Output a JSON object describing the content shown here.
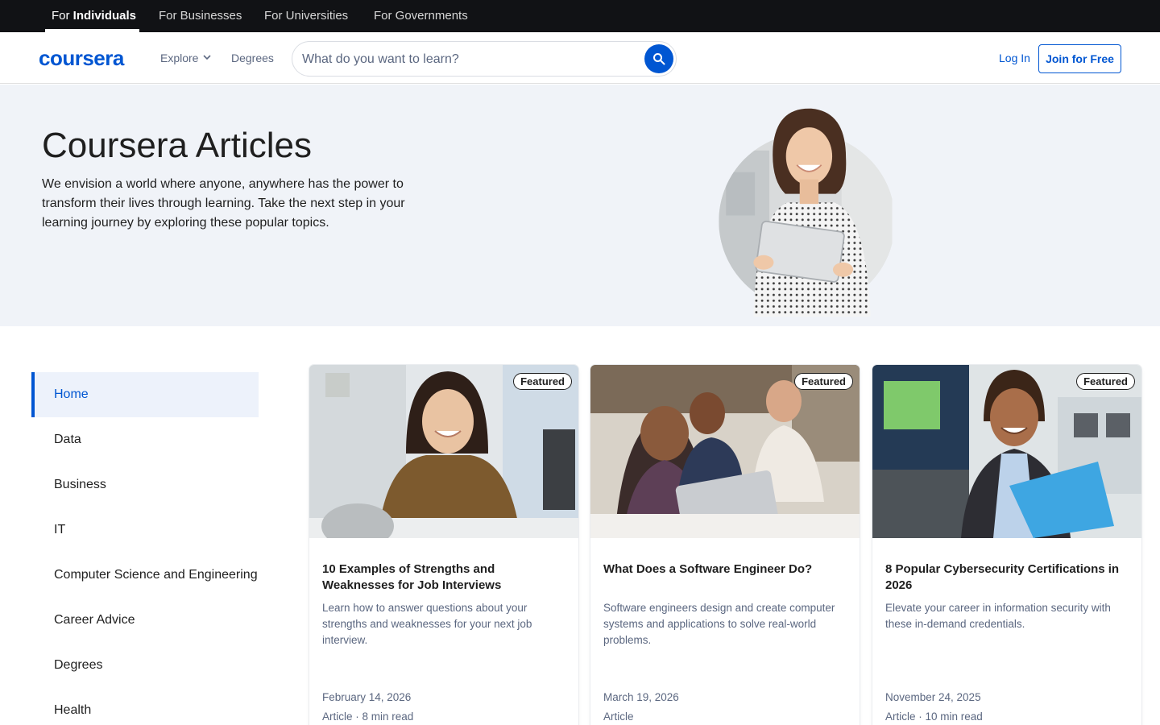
{
  "audience_bar": {
    "tabs": [
      {
        "prefix": "For ",
        "strong": "Individuals"
      },
      {
        "label": "For Businesses"
      },
      {
        "label": "For Universities"
      },
      {
        "label": "For Governments"
      }
    ]
  },
  "header": {
    "logo": "coursera",
    "explore_label": "Explore",
    "degrees_label": "Degrees",
    "search_placeholder": "What do you want to learn?",
    "login_label": "Log In",
    "join_label": "Join for Free"
  },
  "hero": {
    "title": "Coursera Articles",
    "description": "We envision a world where anyone, anywhere has the power to transform their lives through learning. Take the next step in your learning journey by exploring these popular topics."
  },
  "sidebar": {
    "items": [
      {
        "label": "Home",
        "active": true
      },
      {
        "label": "Data"
      },
      {
        "label": "Business"
      },
      {
        "label": "IT"
      },
      {
        "label": "Computer Science and Engineering"
      },
      {
        "label": "Career Advice"
      },
      {
        "label": "Degrees"
      },
      {
        "label": "Health"
      }
    ]
  },
  "cards": [
    {
      "badge": "Featured",
      "title": "10 Examples of Strengths and Weaknesses for Job Interviews",
      "description": "Learn how to answer questions about your strengths and weaknesses for your next job interview.",
      "date": "February 14, 2026",
      "meta": "Article · 8 min read"
    },
    {
      "badge": "Featured",
      "title": "What Does a Software Engineer Do?",
      "description": "Software engineers design and create computer systems and applications to solve real-world problems.",
      "date": "March 19, 2026",
      "meta": "Article"
    },
    {
      "badge": "Featured",
      "title": "8 Popular Cybersecurity Certifications in 2026",
      "description": "Elevate your career in information security with these in-demand credentials.",
      "date": "November 24, 2025",
      "meta": "Article · 10 min read"
    }
  ],
  "colors": {
    "brand_blue": "#0056d2",
    "top_bar": "#111215",
    "hero_bg": "#f0f3f8",
    "sidebar_active_bg": "#edf2fb",
    "muted_text": "#5b6780"
  }
}
